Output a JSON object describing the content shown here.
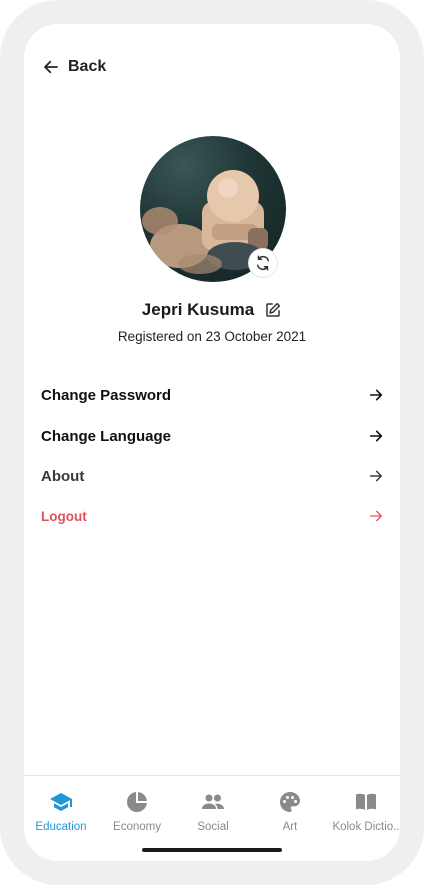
{
  "header": {
    "back_label": "Back"
  },
  "profile": {
    "name": "Jepri Kusuma",
    "registered_text": "Registered on 23 October 2021"
  },
  "menu": {
    "change_password": "Change Password",
    "change_language": "Change Language",
    "about": "About",
    "logout": "Logout"
  },
  "bottom_nav": {
    "items": [
      {
        "label": "Education",
        "icon": "graduation-cap-icon",
        "active": true
      },
      {
        "label": "Economy",
        "icon": "pie-chart-icon",
        "active": false
      },
      {
        "label": "Social",
        "icon": "people-icon",
        "active": false
      },
      {
        "label": "Art",
        "icon": "palette-icon",
        "active": false
      },
      {
        "label": "Kolok Dictio..",
        "icon": "book-icon",
        "active": false
      }
    ]
  },
  "colors": {
    "accent": "#2196d8",
    "logout": "#e0525b",
    "inactive": "#8a8a8a"
  }
}
